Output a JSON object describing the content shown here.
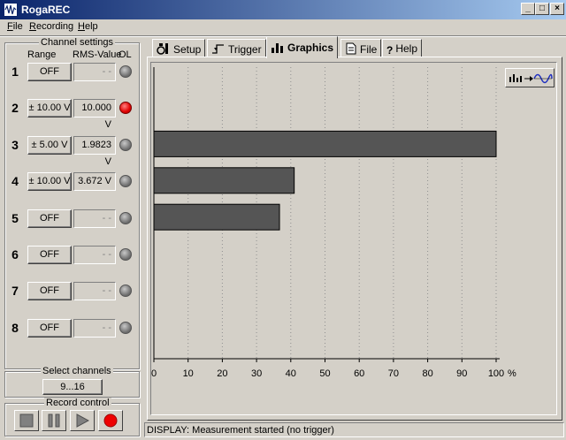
{
  "window": {
    "title": "RogaREC",
    "minimize": "_",
    "maximize": "□",
    "close": "×"
  },
  "menu": [
    {
      "label_u": "F",
      "label_rest": "ile"
    },
    {
      "label_u": "R",
      "label_rest": "ecording"
    },
    {
      "label_u": "H",
      "label_rest": "elp"
    }
  ],
  "channel_settings": {
    "title": "Channel settings",
    "col_range": "Range",
    "col_rms": "RMS-Value",
    "col_ol": "OL",
    "channels": [
      {
        "num": "1",
        "range": "OFF",
        "value": "- -",
        "overload": false
      },
      {
        "num": "2",
        "range": "± 10.00 V",
        "value": "10.000 V",
        "overload": true
      },
      {
        "num": "3",
        "range": "±  5.00 V",
        "value": "1.9823 V",
        "overload": false
      },
      {
        "num": "4",
        "range": "± 10.00 V",
        "value": "3.672 V",
        "overload": false
      },
      {
        "num": "5",
        "range": "OFF",
        "value": "- -",
        "overload": false
      },
      {
        "num": "6",
        "range": "OFF",
        "value": "- -",
        "overload": false
      },
      {
        "num": "7",
        "range": "OFF",
        "value": "- -",
        "overload": false
      },
      {
        "num": "8",
        "range": "OFF",
        "value": "- -",
        "overload": false
      }
    ]
  },
  "select_channels": {
    "title": "Select channels",
    "button": "9...16"
  },
  "record_control": {
    "title": "Record control",
    "buttons": [
      "stop",
      "pause",
      "play",
      "record"
    ]
  },
  "tabs": [
    {
      "label": "Setup",
      "icon": "setup-icon",
      "active": false
    },
    {
      "label": "Trigger",
      "icon": "trigger-icon",
      "active": false
    },
    {
      "label": "Graphics",
      "icon": "bar-graph-icon",
      "active": true
    },
    {
      "label": "File",
      "icon": "file-icon",
      "active": false
    },
    {
      "label": "Help",
      "icon": "help-icon",
      "active": false
    }
  ],
  "colors": {
    "bar": "#555555",
    "led_on": "#e00000",
    "led_off": "#888888",
    "titlebar": "#0a246a"
  },
  "chart_data": {
    "type": "bar",
    "orientation": "horizontal",
    "categories": [
      "1",
      "2",
      "3",
      "4",
      "5",
      "6",
      "7",
      "8"
    ],
    "values": [
      0,
      100,
      41,
      36.7,
      0,
      0,
      0,
      0
    ],
    "xlim": [
      0,
      100
    ],
    "xticks": [
      "0",
      "10",
      "20",
      "30",
      "40",
      "50",
      "60",
      "70",
      "80",
      "90",
      "100"
    ],
    "xunit": "%",
    "grid": "vertical dotted"
  },
  "status_bar": "DISPLAY: Measurement started (no trigger)"
}
